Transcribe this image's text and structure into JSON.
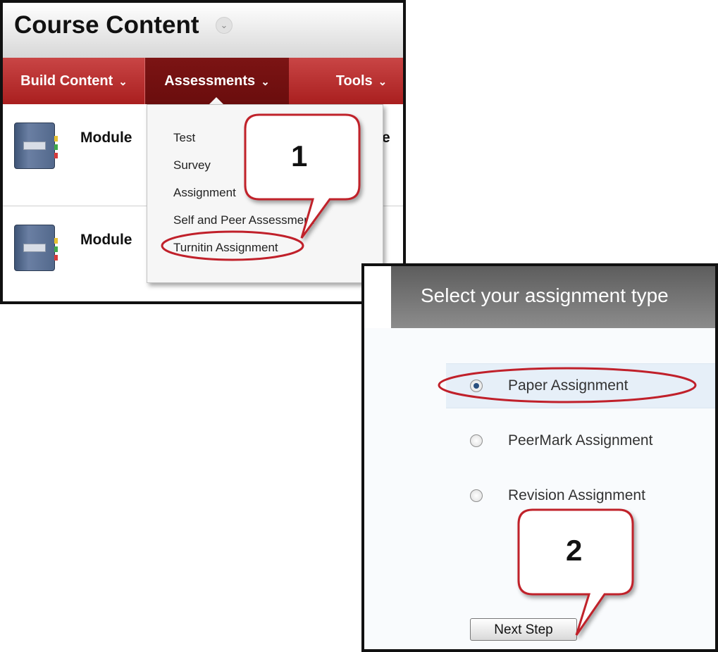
{
  "course_panel": {
    "title": "Course Content",
    "title_menu_icon": "chevron-down-icon",
    "menu": {
      "build_content": "Build Content",
      "assessments": "Assessments",
      "tools": "Tools"
    },
    "modules": [
      {
        "title": "Module",
        "icon": "notebook-icon"
      },
      {
        "title": "Module",
        "icon": "notebook-icon"
      }
    ],
    "module_1_trailing_text": "e",
    "assessments_dropdown": {
      "items": [
        "Test",
        "Survey",
        "Assignment",
        "Self and Peer Assessment",
        "Turnitin Assignment"
      ]
    }
  },
  "assignment_type_panel": {
    "title": "Select your assignment type",
    "options": [
      {
        "label": "Paper Assignment",
        "selected": true
      },
      {
        "label": "PeerMark Assignment",
        "selected": false
      },
      {
        "label": "Revision Assignment",
        "selected": false
      }
    ],
    "next_button": "Next Step"
  },
  "annotations": {
    "callout_1": "1",
    "callout_2": "2",
    "highlight_color": "#c0202a"
  },
  "colors": {
    "menu_red": "#b52a2a",
    "menu_active": "#6e0f0f",
    "panel_header_gray": "#757575"
  }
}
